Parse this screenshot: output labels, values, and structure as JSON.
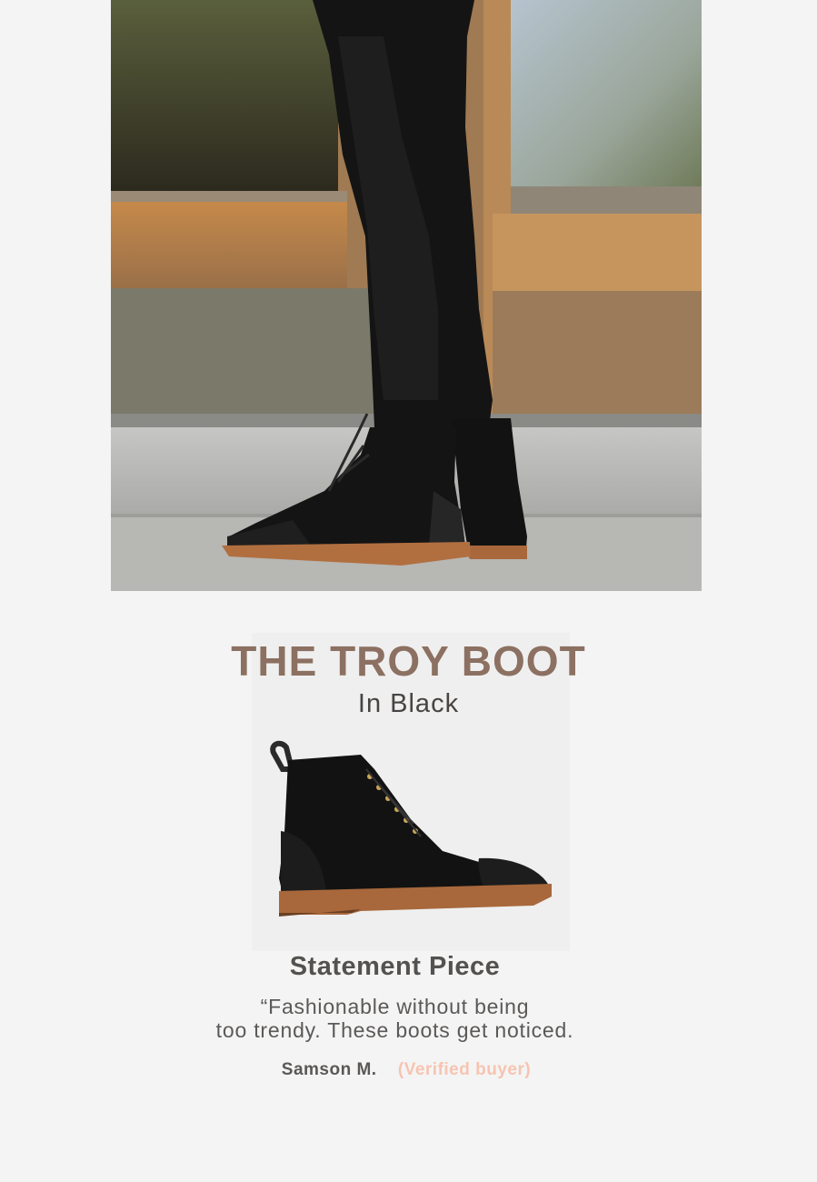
{
  "hero": {
    "image": "lifestyle-photo-boots-on-step"
  },
  "product": {
    "title": "THE TROY BOOT",
    "subtitle": "In Black",
    "image": "black-suede-cap-toe-boot"
  },
  "review": {
    "title": "Statement Piece",
    "quote_line1": "“Fashionable without being",
    "quote_line2": "too trendy. These boots get noticed.",
    "author": "Samson M.",
    "verified": "(Verified buyer)"
  },
  "colors": {
    "background": "#f4f4f4",
    "title": "#8c7061",
    "verified": "#f6c4b1",
    "text": "#545250"
  }
}
